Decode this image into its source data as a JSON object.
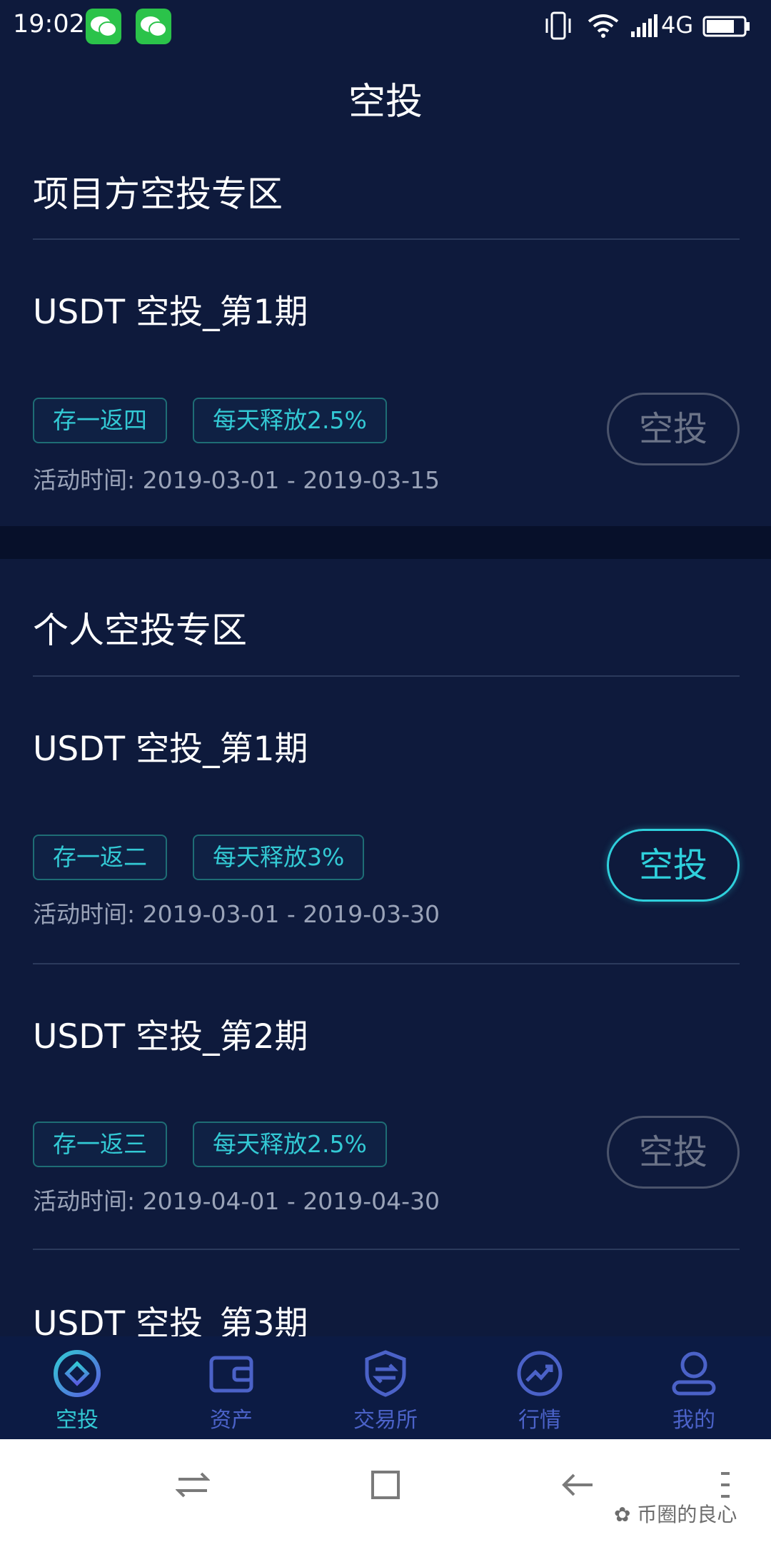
{
  "status_bar": {
    "time": "19:02",
    "network": "4G"
  },
  "page_title": "空投",
  "sections": {
    "project": {
      "title": "项目方空投专区",
      "cards": [
        {
          "title": "USDT 空投_第1期",
          "tags": [
            "存一返四",
            "每天释放2.5%"
          ],
          "time": "活动时间: 2019-03-01 - 2019-03-15",
          "button": "空投",
          "button_state": "disabled"
        }
      ]
    },
    "personal": {
      "title": "个人空投专区",
      "cards": [
        {
          "title": "USDT 空投_第1期",
          "tags": [
            "存一返二",
            "每天释放3%"
          ],
          "time": "活动时间: 2019-03-01 - 2019-03-30",
          "button": "空投",
          "button_state": "active"
        },
        {
          "title": "USDT 空投_第2期",
          "tags": [
            "存一返三",
            "每天释放2.5%"
          ],
          "time": "活动时间: 2019-04-01 - 2019-04-30",
          "button": "空投",
          "button_state": "disabled"
        },
        {
          "title": "USDT 空投_第3期"
        }
      ]
    }
  },
  "bottom_nav": [
    {
      "label": "空投",
      "icon": "airdrop-icon",
      "active": true
    },
    {
      "label": "资产",
      "icon": "wallet-icon",
      "active": false
    },
    {
      "label": "交易所",
      "icon": "exchange-icon",
      "active": false
    },
    {
      "label": "行情",
      "icon": "market-icon",
      "active": false
    },
    {
      "label": "我的",
      "icon": "profile-icon",
      "active": false
    }
  ],
  "watermark": "币圈的良心",
  "colors": {
    "background": "#0e1a3c",
    "accent": "#33c9d4",
    "nav_inactive": "#4b62c8",
    "muted": "#9aa3b8"
  }
}
